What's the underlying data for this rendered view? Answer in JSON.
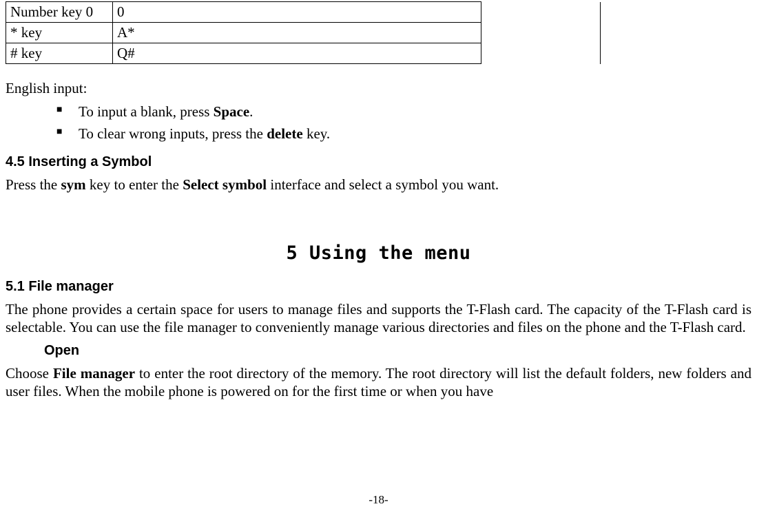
{
  "table": {
    "rows": [
      {
        "c1": "Number key 0",
        "c2": "0"
      },
      {
        "c1": "* key",
        "c2": "A*"
      },
      {
        "c1": "# key",
        "c2": "Q#"
      }
    ]
  },
  "english_input_label": "English input:",
  "bullets": {
    "b1_pre": "To input a blank, press ",
    "b1_bold": "Space",
    "b1_post": ".",
    "b2_pre": "To clear wrong inputs, press the ",
    "b2_bold": "delete",
    "b2_post": " key."
  },
  "sec45_title": "4.5    Inserting a Symbol",
  "sec45_body": {
    "pre": "Press the ",
    "b1": "sym",
    "mid": " key to enter the ",
    "b2": "Select symbol",
    "post": " interface and select a symbol you want."
  },
  "chapter5_title": "5  Using the menu",
  "sec51_title": "5.1    File manager",
  "sec51_body": "The phone provides a certain space for users to manage files and supports the T-Flash card. The capacity of the T-Flash card is selectable. You can use the file manager to conveniently manage various directories and files on the phone and the T-Flash card.",
  "open_title": "Open",
  "open_body": {
    "pre": "Choose ",
    "bold": "File manager",
    "post": " to enter the root directory of the memory. The root directory will list the default folders, new folders and user files. When the mobile phone is powered on for the first time or when you have"
  },
  "footer": "-18-"
}
